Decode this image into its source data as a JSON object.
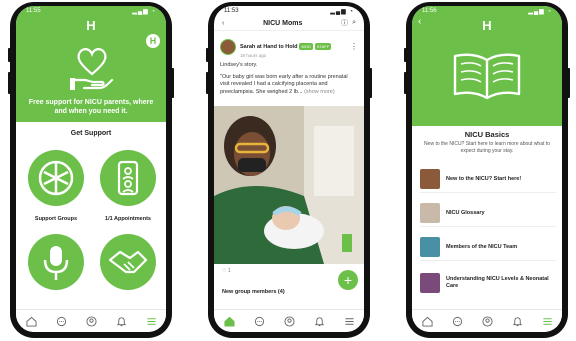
{
  "phone1": {
    "status_time": "11:55",
    "logo": "H",
    "badge": "H",
    "tagline": "Free support for NICU parents, where and when you need it.",
    "get_support": "Get Support",
    "cards": [
      {
        "label": "Support Groups",
        "icon": "hands-together-icon"
      },
      {
        "label": "1/1 Appointments",
        "icon": "video-call-icon"
      },
      {
        "label": "",
        "icon": "microphone-icon"
      },
      {
        "label": "",
        "icon": "handshake-icon"
      }
    ]
  },
  "phone2": {
    "status_time": "11:53",
    "title": "NICU Moms",
    "author": "Sarah at Hand to Hold",
    "tags": [
      "MOD",
      "STAFF"
    ],
    "time": "18 hours ago",
    "story_title": "Lindsey's story.",
    "story_text": "\"Our baby girl was born early after a routine prenatal visit revealed I had a calcifying placenta and preeclampsia. She weighed 2 lb...",
    "show_more": "(show more)",
    "likes": "1",
    "new_members": "New group members (4)"
  },
  "phone3": {
    "status_time": "11:56",
    "logo": "H",
    "title": "NICU Basics",
    "subtitle": "New to the NICU? Start here to learn more about what to expect during your stay.",
    "items": [
      {
        "label": "New to the NICU? Start here!",
        "color": "#8a5a3a"
      },
      {
        "label": "NICU Glossary",
        "color": "#c9b9a8"
      },
      {
        "label": "Members of the NICU Team",
        "color": "#4a90a4"
      },
      {
        "label": "Understanding NICU Levels & Neonatal Care",
        "color": "#7a4a7a"
      }
    ]
  },
  "colors": {
    "accent": "#6cc04a"
  }
}
